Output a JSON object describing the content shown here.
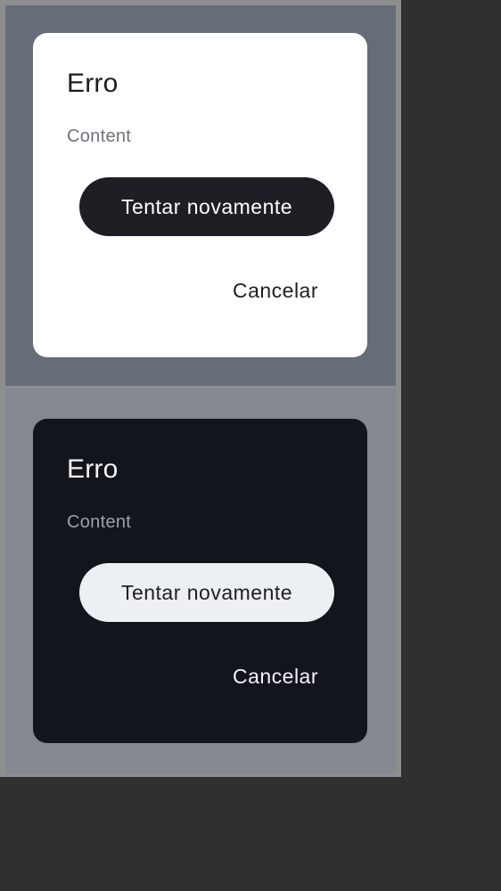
{
  "previews": {
    "light": {
      "dialog": {
        "title": "Erro",
        "content": "Content",
        "primary_button": "Tentar novamente",
        "secondary_button": "Cancelar"
      }
    },
    "dark": {
      "dialog": {
        "title": "Erro",
        "content": "Content",
        "primary_button": "Tentar novamente",
        "secondary_button": "Cancelar"
      }
    }
  },
  "colors": {
    "light_backdrop": "#666d76",
    "light_surface": "#ffffff",
    "dark_backdrop": "#848891",
    "dark_surface": "#12151b",
    "outer_background": "#303030"
  }
}
